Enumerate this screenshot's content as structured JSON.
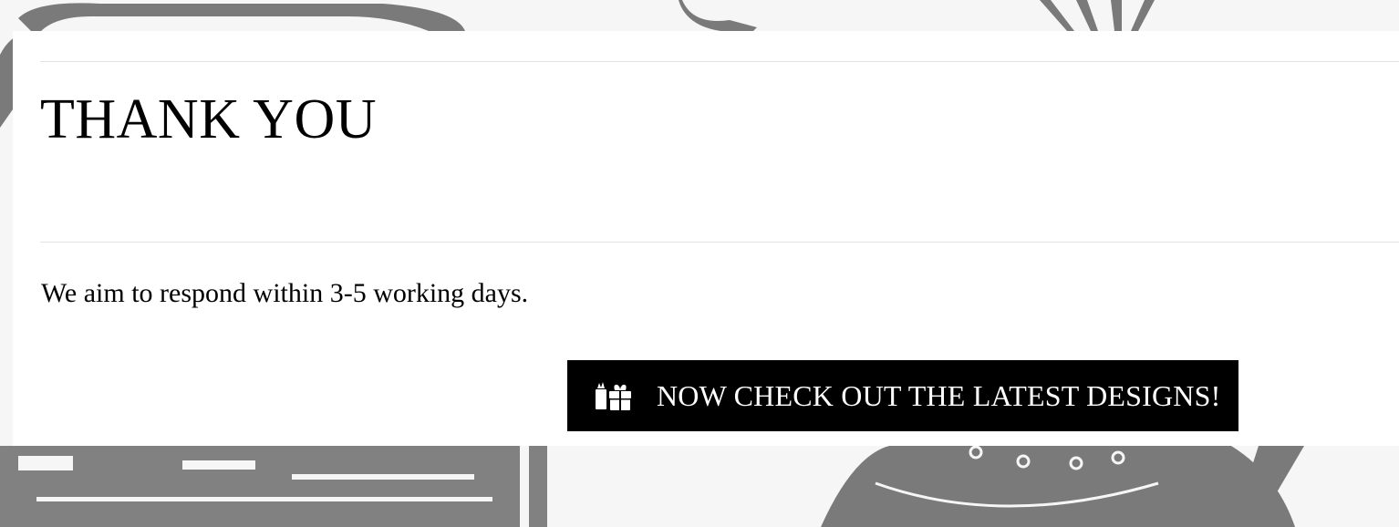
{
  "page": {
    "title": "THANK YOU",
    "message": "We aim to respond within 3-5 working days."
  },
  "cta": {
    "label": "NOW CHECK OUT THE LATEST DESIGNS!",
    "icon": "gifts-icon"
  },
  "colors": {
    "background": "#f6f6f6",
    "panel": "#ffffff",
    "button": "#000000",
    "button_text": "#ffffff",
    "art": "#7a7a7a"
  }
}
